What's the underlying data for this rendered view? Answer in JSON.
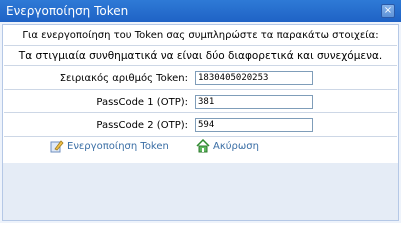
{
  "dialog": {
    "title": "Ενεργοποίηση Token",
    "close_symbol": "×",
    "instruction": "Για ενεργοποίηση του Token σας συμπληρώστε τα παρακάτω στοιχεία:",
    "note": "Τα στιγμιαία συνθηματικά να είναι δύο διαφορετικά και συνεχόμενα.",
    "fields": [
      {
        "label": "Σειριακός αριθμός Token:",
        "value": "1830405020253"
      },
      {
        "label": "PassCode 1 (OTP):",
        "value": "381"
      },
      {
        "label": "PassCode 2 (OTP):",
        "value": "594"
      }
    ],
    "actions": {
      "activate_label": "Ενεργοποίηση Token",
      "cancel_label": "Ακύρωση"
    },
    "icons": {
      "activate": "edit-pencil-icon",
      "cancel": "home-icon"
    },
    "colors": {
      "titlebar": "#1f62c5",
      "link": "#3a6ea5"
    }
  }
}
